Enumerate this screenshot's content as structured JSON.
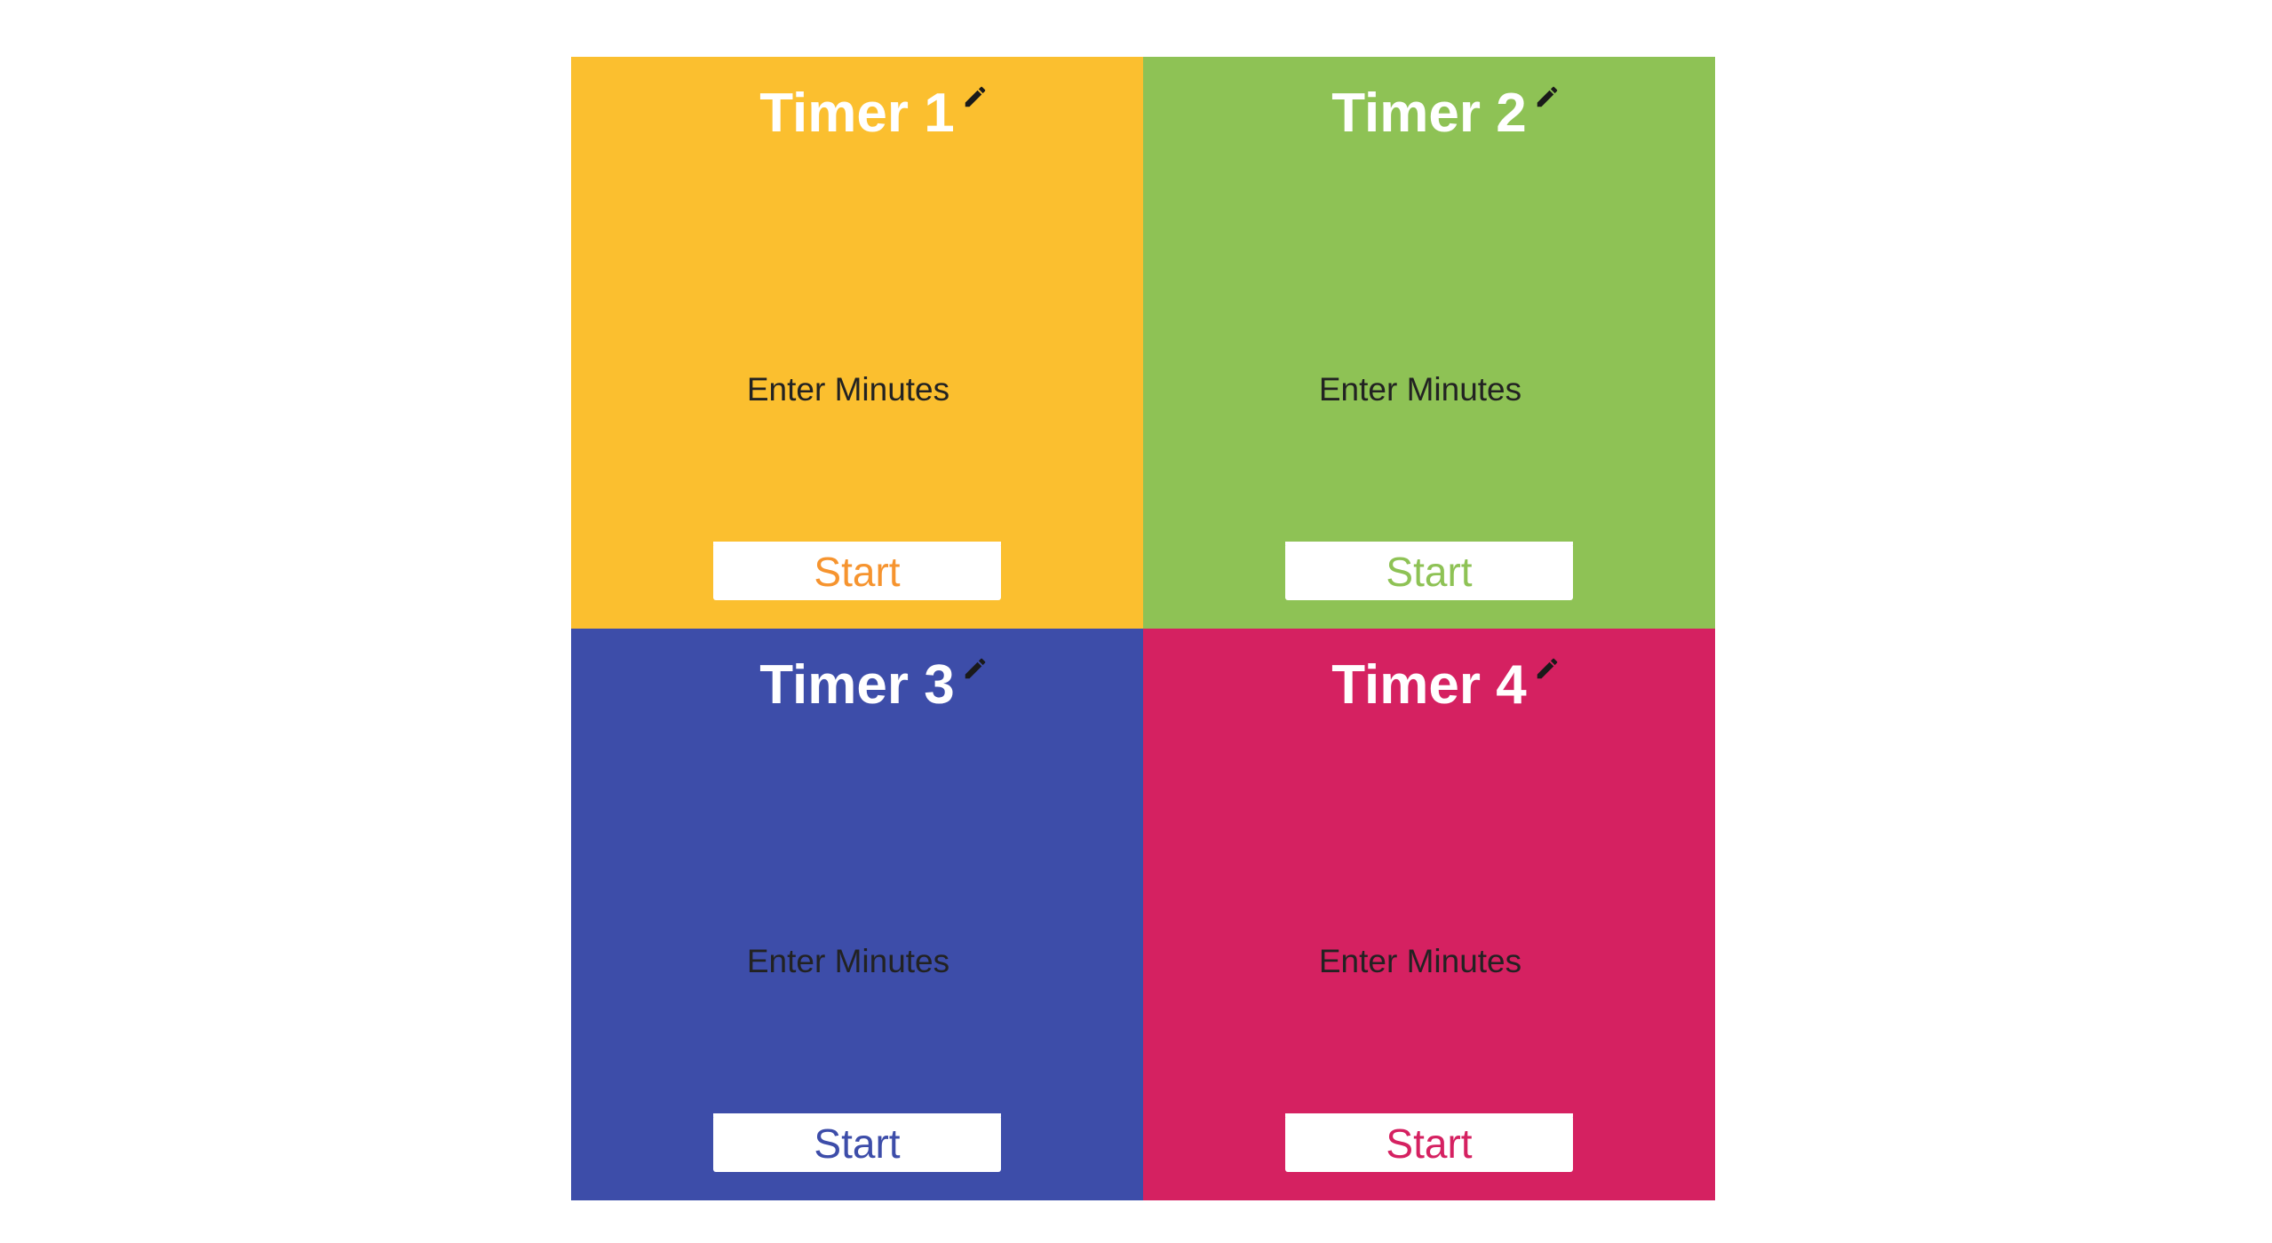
{
  "timers": [
    {
      "title": "Timer 1",
      "label": "Enter Minutes",
      "input_value": "",
      "button_label": "Start",
      "bg_color": "#FBBF2F",
      "button_text_color": "#F6942F"
    },
    {
      "title": "Timer 2",
      "label": "Enter Minutes",
      "input_value": "",
      "button_label": "Start",
      "bg_color": "#8EC255",
      "button_text_color": "#8EC255"
    },
    {
      "title": "Timer 3",
      "label": "Enter Minutes",
      "input_value": "",
      "button_label": "Start",
      "bg_color": "#3D4DA9",
      "button_text_color": "#3D4DA9"
    },
    {
      "title": "Timer 4",
      "label": "Enter Minutes",
      "input_value": "",
      "button_label": "Start",
      "bg_color": "#D52161",
      "button_text_color": "#D52161"
    }
  ],
  "icons": {
    "edit": "pencil-icon"
  }
}
